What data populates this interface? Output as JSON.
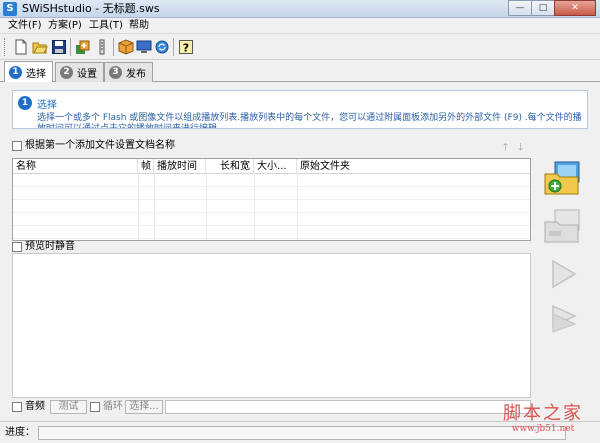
{
  "window": {
    "title": "SWiSHstudio - 无标题.sws",
    "icon_letter": "S",
    "minimize": "—",
    "maximize": "□",
    "close": "✕"
  },
  "menu": [
    "文件(F)",
    "方案(P)",
    "工具(T)",
    "帮助"
  ],
  "toolbar_icons": [
    "new-file-icon",
    "open-folder-icon",
    "save-icon",
    "add-files-icon",
    "properties-icon",
    "package-icon",
    "screen-icon",
    "refresh-icon",
    "help-icon"
  ],
  "tabs": [
    {
      "num": "1",
      "label": "选择",
      "active": true
    },
    {
      "num": "2",
      "label": "设置",
      "active": false
    },
    {
      "num": "3",
      "label": "发布",
      "active": false
    }
  ],
  "info": {
    "num": "1",
    "title": "选择",
    "description": "选择一个或多个 Flash 或图像文件以组成播放列表.播放列表中的每个文件，您可以通过附属面板添加另外的外部文件 (F9) .每个文件的播放时间可以通过点击它的播放时间来进行编辑。"
  },
  "options": {
    "name_from_first": "根据第一个添加文件设置文档名称",
    "mute_preview": "预览时静音"
  },
  "list": {
    "columns": [
      "名称",
      "帧",
      "播放时间",
      "长和宽",
      "大小...",
      "原始文件夹"
    ],
    "rows": []
  },
  "bottom": {
    "audio": "音频",
    "test": "测试",
    "loop": "循环",
    "select": "选择..."
  },
  "status": {
    "progress_label": "进度："
  },
  "colors": {
    "accent": "#1f6fc8",
    "info_text": "#2a5fa8",
    "watermark": "#d9534f"
  },
  "watermark": {
    "main": "脚本之家",
    "sub": "www.jb51.net"
  }
}
